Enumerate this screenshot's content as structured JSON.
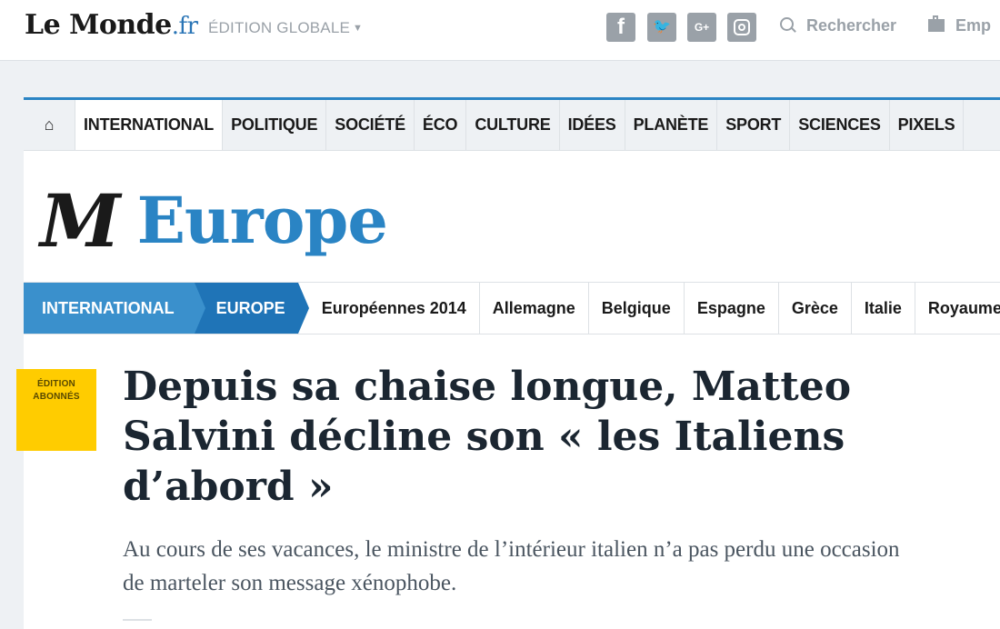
{
  "header": {
    "logo_main": "Le Monde",
    "logo_suffix": ".fr",
    "edition": "ÉDITION GLOBALE",
    "search_label": "Rechercher",
    "jobs_label": "Emp"
  },
  "social": {
    "facebook": "f",
    "twitter": "t",
    "googleplus": "G+"
  },
  "main_nav": [
    "INTERNATIONAL",
    "POLITIQUE",
    "SOCIÉTÉ",
    "ÉCO",
    "CULTURE",
    "IDÉES",
    "PLANÈTE",
    "SPORT",
    "SCIENCES",
    "PIXELS"
  ],
  "section": {
    "monogram": "M",
    "title": "Europe"
  },
  "sub_nav": {
    "crumbs": [
      "INTERNATIONAL",
      "EUROPE"
    ],
    "items": [
      "Européennes 2014",
      "Allemagne",
      "Belgique",
      "Espagne",
      "Grèce",
      "Italie",
      "Royaume-Uni"
    ]
  },
  "article": {
    "badge_line1": "ÉDITION",
    "badge_line2": "ABONNÉS",
    "title": "Depuis sa chaise longue, Matteo Salvini décline son « les Italiens d’abord »",
    "standfirst": "Au cours de ses vacances, le ministre de l’intérieur italien n’a pas perdu une occasion de marteler son message xénophobe."
  },
  "colors": {
    "accent": "#2a84c4",
    "badge": "#ffcc00",
    "background": "#eef1f4"
  }
}
